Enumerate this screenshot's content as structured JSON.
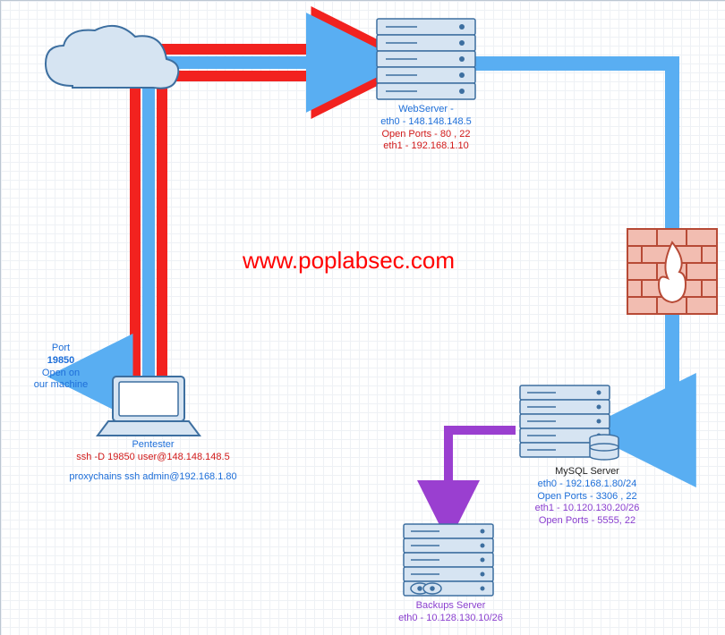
{
  "watermark": "www.poplabsec.com",
  "nodes": {
    "cloud": {
      "name": "cloud"
    },
    "pentester": {
      "name": "pentester-laptop"
    },
    "webserver": {
      "name": "webserver"
    },
    "firewall": {
      "name": "firewall"
    },
    "mysqlserver": {
      "name": "mysql-server"
    },
    "backups": {
      "name": "backups-server"
    }
  },
  "labels": {
    "port_open": {
      "line1": "Port",
      "line2": "19850",
      "line3": "Open on",
      "line4": "our machine"
    },
    "pentester": {
      "title": "Pentester",
      "ssh": "ssh -D 19850 user@148.148.148.5",
      "proxy": "proxychains ssh admin@192.168.1.80"
    },
    "webserver": {
      "l1": "WebServer -",
      "l2": "eth0 - 148.148.148.5",
      "l3": "Open Ports - 80 , 22",
      "l4": "eth1 - 192.168.1.10"
    },
    "mysql": {
      "l1": "MySQL Server",
      "l2": "eth0 - 192.168.1.80/24",
      "l3": "Open Ports - 3306 , 22",
      "l4": "eth1 - 10.120.130.20/26",
      "l5": "Open Ports - 5555, 22"
    },
    "backups": {
      "l1": "Backups  Server",
      "l2": "eth0 - 10.128.130.10/26"
    }
  },
  "colors": {
    "pipe_blue": "#59aef2",
    "pipe_red": "#f2221f",
    "pipe_purple": "#9a3fd0",
    "shape_stroke": "#3d6fa0",
    "shape_fill": "#d6e4f2",
    "firewall_fill": "#f2bdb1",
    "firewall_stroke": "#b74a36"
  }
}
